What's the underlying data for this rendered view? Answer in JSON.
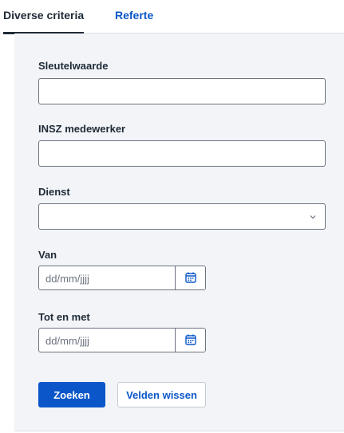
{
  "tabs": [
    {
      "label": "Diverse criteria",
      "active": true
    },
    {
      "label": "Referte",
      "active": false
    }
  ],
  "form": {
    "key_value": {
      "label": "Sleutelwaarde",
      "value": ""
    },
    "employee_insz": {
      "label": "INSZ medewerker",
      "value": ""
    },
    "service": {
      "label": "Dienst",
      "selected": ""
    },
    "from": {
      "label": "Van",
      "placeholder": "dd/mm/jjjj"
    },
    "until": {
      "label": "Tot en met",
      "placeholder": "dd/mm/jjjj"
    }
  },
  "actions": {
    "search_label": "Zoeken",
    "clear_label": "Velden wissen"
  },
  "icons": {
    "calendar": "calendar-icon",
    "chevron": "chevron-down-icon"
  },
  "colors": {
    "accent": "#0b57c9",
    "panel_bg": "#f2f4f7",
    "text": "#1f2a37"
  }
}
